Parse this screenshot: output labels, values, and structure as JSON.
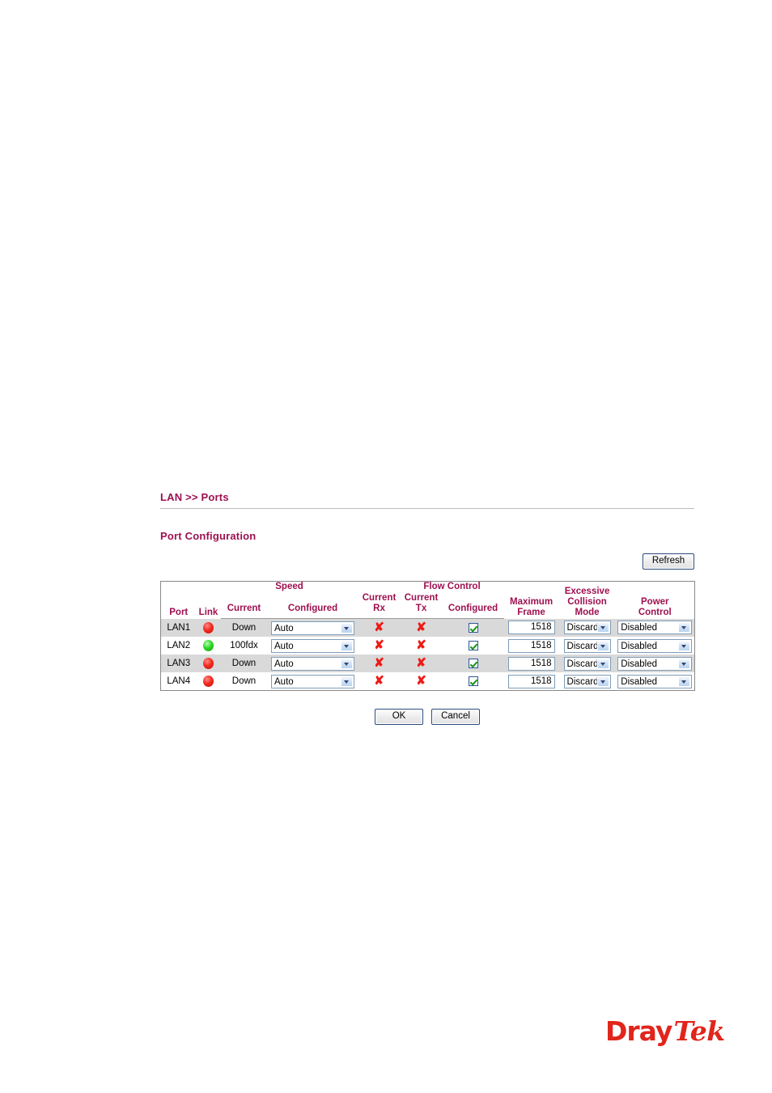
{
  "breadcrumb": "LAN >> Ports",
  "section_title": "Port Configuration",
  "toolbar": {
    "refresh_label": "Refresh"
  },
  "actions": {
    "ok_label": "OK",
    "cancel_label": "Cancel"
  },
  "table": {
    "headers": {
      "port": "Port",
      "link": "Link",
      "speed_group": "Speed",
      "speed_current": "Current",
      "speed_configured": "Configured",
      "flow_control_group": "Flow Control",
      "fc_current_rx_line1": "Current",
      "fc_current_rx_line2": "Rx",
      "fc_current_tx_line1": "Current",
      "fc_current_tx_line2": "Tx",
      "fc_configured": "Configured",
      "max_frame_line1": "Maximum",
      "max_frame_line2": "Frame",
      "ecm_line1": "Excessive",
      "ecm_line2": "Collision",
      "ecm_line3": "Mode",
      "power_line1": "Power",
      "power_line2": "Control"
    },
    "rows": [
      {
        "port": "LAN1",
        "link_state": "down",
        "link_icon": "led-red-icon",
        "speed_current": "Down",
        "speed_configured": "Auto",
        "fc_current_rx": "x-mark-icon",
        "fc_current_tx": "x-mark-icon",
        "fc_configured_checked": true,
        "max_frame": "1518",
        "excessive_collision_mode": "Discard",
        "power_control": "Disabled"
      },
      {
        "port": "LAN2",
        "link_state": "up",
        "link_icon": "led-green-icon",
        "speed_current": "100fdx",
        "speed_configured": "Auto",
        "fc_current_rx": "x-mark-icon",
        "fc_current_tx": "x-mark-icon",
        "fc_configured_checked": true,
        "max_frame": "1518",
        "excessive_collision_mode": "Discard",
        "power_control": "Disabled"
      },
      {
        "port": "LAN3",
        "link_state": "down",
        "link_icon": "led-red-icon",
        "speed_current": "Down",
        "speed_configured": "Auto",
        "fc_current_rx": "x-mark-icon",
        "fc_current_tx": "x-mark-icon",
        "fc_configured_checked": true,
        "max_frame": "1518",
        "excessive_collision_mode": "Discard",
        "power_control": "Disabled"
      },
      {
        "port": "LAN4",
        "link_state": "down",
        "link_icon": "led-red-icon",
        "speed_current": "Down",
        "speed_configured": "Auto",
        "fc_current_rx": "x-mark-icon",
        "fc_current_tx": "x-mark-icon",
        "fc_configured_checked": true,
        "max_frame": "1518",
        "excessive_collision_mode": "Discard",
        "power_control": "Disabled"
      }
    ]
  },
  "logo": {
    "part1": "Dray",
    "part2": "Tek"
  },
  "colors": {
    "brand_red": "#e1251b",
    "heading_maroon": "#9e1050",
    "status_error_red": "#ee1b16",
    "check_green": "#169416",
    "led_red": "#f22b22",
    "led_green": "#2fd62a",
    "row_alt_bg": "#d9d9d9"
  },
  "glyphs": {
    "x_mark": "✘"
  }
}
